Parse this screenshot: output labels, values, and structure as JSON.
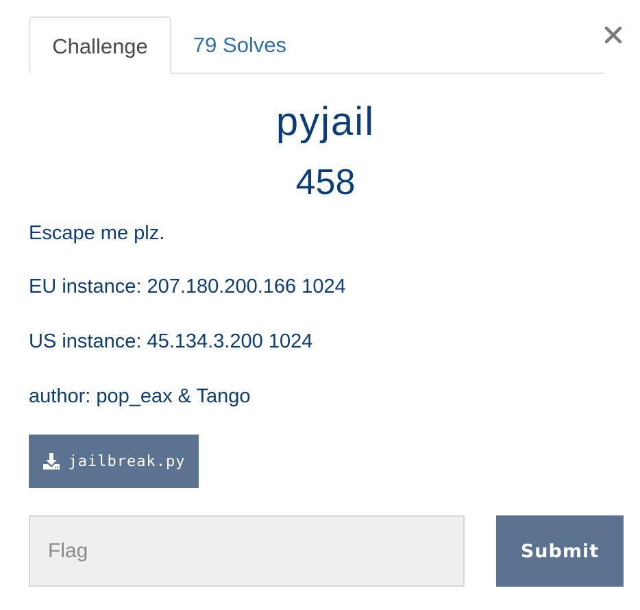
{
  "tabs": {
    "challenge_label": "Challenge",
    "solves_label": "79 Solves"
  },
  "close": {
    "icon": "close-icon"
  },
  "challenge": {
    "name": "pyjail",
    "points": "458",
    "description": [
      "Escape me plz.",
      "EU instance: 207.180.200.166 1024",
      "US instance: 45.134.3.200 1024",
      "author: pop_eax & Tango"
    ]
  },
  "file": {
    "icon": "download-icon",
    "label": "jailbreak.py"
  },
  "flag": {
    "placeholder": "Flag",
    "value": ""
  },
  "submit": {
    "label": "Submit"
  },
  "colors": {
    "title_text": "#0b3d7a",
    "tab_link": "#2f6fad",
    "button_bg": "#5b7291",
    "input_bg": "#efefef"
  }
}
